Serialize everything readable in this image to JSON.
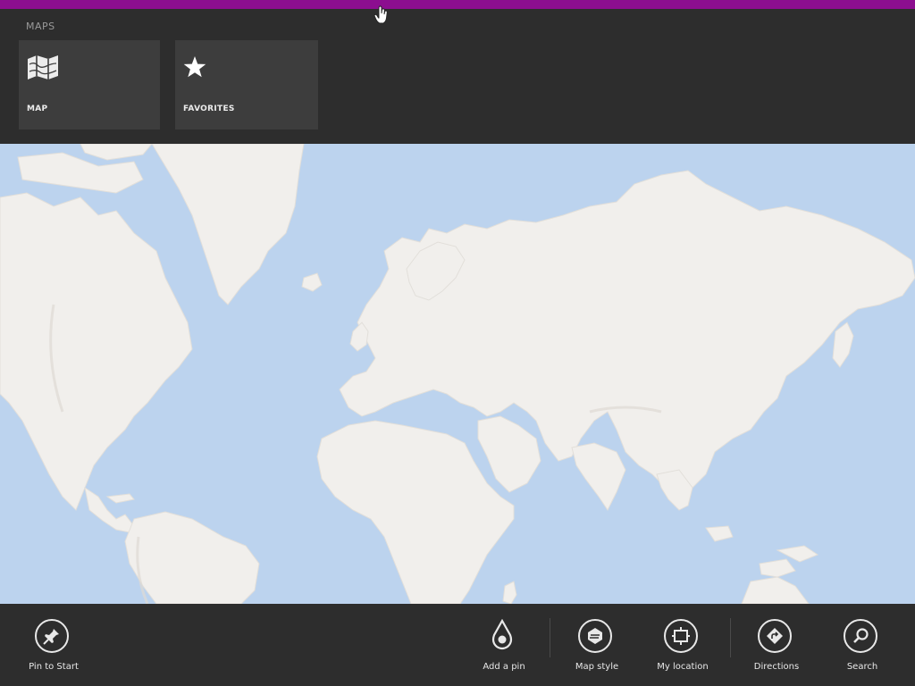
{
  "nav": {
    "title": "MAPS",
    "tiles": [
      {
        "label": "MAP",
        "icon": "map-icon"
      },
      {
        "label": "FAVORITES",
        "icon": "star-icon"
      }
    ]
  },
  "app_bar": {
    "pin_to_start": {
      "label": "Pin to Start",
      "icon": "pin-icon"
    },
    "add_a_pin": {
      "label": "Add a pin",
      "icon": "drop-pin-icon"
    },
    "map_style": {
      "label": "Map style",
      "icon": "map-style-icon"
    },
    "my_location": {
      "label": "My location",
      "icon": "location-icon"
    },
    "directions": {
      "label": "Directions",
      "icon": "directions-icon"
    },
    "search": {
      "label": "Search",
      "icon": "search-icon"
    }
  },
  "colors": {
    "accent": "#8c0e8f",
    "chrome": "#2d2d2d",
    "tile": "#3d3d3d",
    "water": "#bcd3ee",
    "land": "#f1efec"
  }
}
